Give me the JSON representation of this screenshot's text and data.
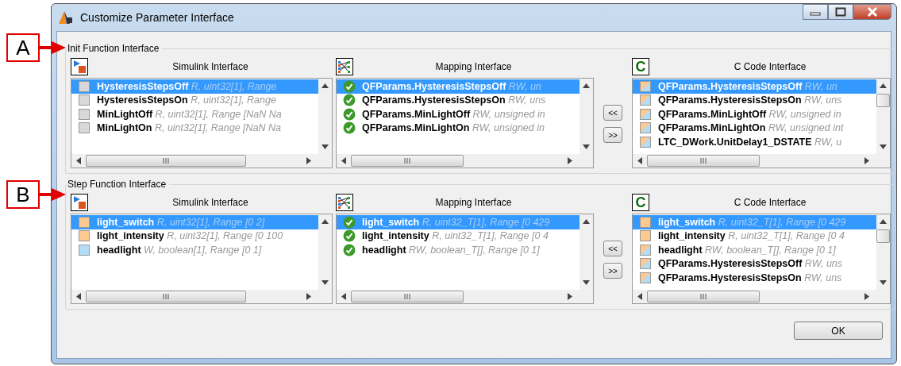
{
  "window": {
    "title": "Customize Parameter Interface"
  },
  "callouts": [
    {
      "label": "A"
    },
    {
      "label": "B"
    }
  ],
  "groups": [
    {
      "title": "Init Function Interface",
      "move_buttons": [
        "<<",
        ">>"
      ],
      "panels": [
        {
          "kind": "simulink",
          "title": "Simulink Interface",
          "items": [
            {
              "kind": "empty",
              "name": "HysteresisStepsOff",
              "detail": "R, uint32[1], Range",
              "selected": true
            },
            {
              "kind": "empty",
              "name": "HysteresisStepsOn",
              "detail": "R, uint32[1], Range",
              "selected": false
            },
            {
              "kind": "empty",
              "name": "MinLightOff",
              "detail": "R, uint32[1], Range [NaN Na",
              "selected": false
            },
            {
              "kind": "empty",
              "name": "MinLightOn",
              "detail": "R, uint32[1], Range [NaN Na",
              "selected": false
            }
          ]
        },
        {
          "kind": "mapping",
          "title": "Mapping Interface",
          "items": [
            {
              "kind": "check",
              "name": "QFParams.HysteresisStepsOff",
              "detail": "RW, un",
              "selected": true
            },
            {
              "kind": "check",
              "name": "QFParams.HysteresisStepsOn",
              "detail": "RW, uns",
              "selected": false
            },
            {
              "kind": "check",
              "name": "QFParams.MinLightOff",
              "detail": "RW, unsigned in",
              "selected": false
            },
            {
              "kind": "check",
              "name": "QFParams.MinLightOn",
              "detail": "RW, unsigned in",
              "selected": false
            }
          ]
        },
        {
          "kind": "ccode",
          "title": "C Code Interface",
          "logo": "C",
          "items": [
            {
              "kind": "inout",
              "name": "QFParams.HysteresisStepsOff",
              "detail": "RW, un",
              "selected": true
            },
            {
              "kind": "inout",
              "name": "QFParams.HysteresisStepsOn",
              "detail": "RW, uns",
              "selected": false
            },
            {
              "kind": "inout",
              "name": "QFParams.MinLightOff",
              "detail": "RW, unsigned in",
              "selected": false
            },
            {
              "kind": "inout",
              "name": "QFParams.MinLightOn",
              "detail": "RW, unsigned int",
              "selected": false
            },
            {
              "kind": "inout",
              "name": "LTC_DWork.UnitDelay1_DSTATE",
              "detail": "RW, u",
              "selected": false
            }
          ]
        }
      ]
    },
    {
      "title": "Step Function Interface",
      "move_buttons": [
        "<<",
        ">>"
      ],
      "panels": [
        {
          "kind": "simulink",
          "title": "Simulink Interface",
          "items": [
            {
              "kind": "input",
              "name": "light_switch",
              "detail": "R, uint32[1], Range [0 2]",
              "selected": true
            },
            {
              "kind": "input",
              "name": "light_intensity",
              "detail": "R, uint32[1], Range [0 100",
              "selected": false
            },
            {
              "kind": "output",
              "name": "headlight",
              "detail": "W, boolean[1], Range [0 1]",
              "selected": false
            }
          ]
        },
        {
          "kind": "mapping",
          "title": "Mapping Interface",
          "items": [
            {
              "kind": "check",
              "name": "light_switch",
              "detail": "R, uint32_T[1], Range [0 429",
              "selected": true
            },
            {
              "kind": "check",
              "name": "light_intensity",
              "detail": "R, uint32_T[1], Range [0 4",
              "selected": false
            },
            {
              "kind": "check",
              "name": "headlight",
              "detail": "RW, boolean_T[], Range [0 1]",
              "selected": false
            }
          ]
        },
        {
          "kind": "ccode",
          "title": "C Code Interface",
          "logo": "C",
          "items": [
            {
              "kind": "input",
              "name": "light_switch",
              "detail": "R, uint32_T[1], Range [0 429",
              "selected": true
            },
            {
              "kind": "input",
              "name": "light_intensity",
              "detail": "R, uint32_T[1], Range [0 4",
              "selected": false
            },
            {
              "kind": "inout",
              "name": "headlight",
              "detail": "RW, boolean_T[], Range [0 1]",
              "selected": false
            },
            {
              "kind": "inout",
              "name": "QFParams.HysteresisStepsOff",
              "detail": "RW, uns",
              "selected": false
            },
            {
              "kind": "inout",
              "name": "QFParams.HysteresisStepsOn",
              "detail": "RW, uns",
              "selected": false
            }
          ]
        }
      ]
    }
  ],
  "ok_button": "OK"
}
